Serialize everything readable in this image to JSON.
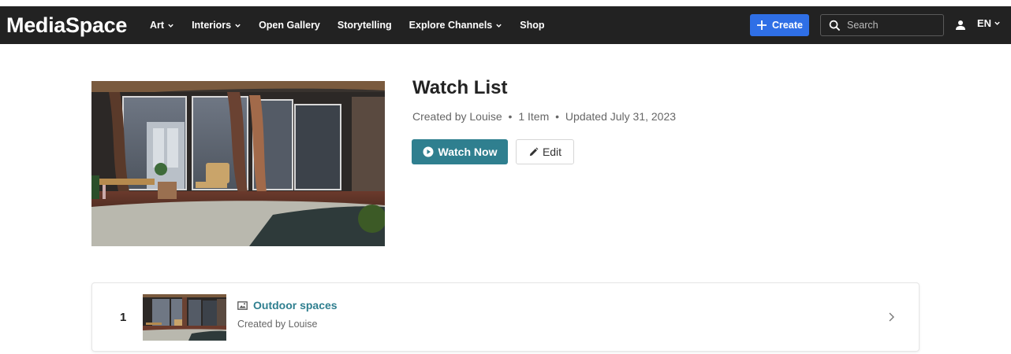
{
  "header": {
    "brand": "MediaSpace",
    "nav": [
      {
        "label": "Art",
        "has_menu": true
      },
      {
        "label": "Interiors",
        "has_menu": true
      },
      {
        "label": "Open Gallery",
        "has_menu": false
      },
      {
        "label": "Storytelling",
        "has_menu": false
      },
      {
        "label": "Explore Channels",
        "has_menu": true
      },
      {
        "label": "Shop",
        "has_menu": false
      }
    ],
    "create_label": "Create",
    "search_placeholder": "Search",
    "language": "EN"
  },
  "playlist": {
    "title": "Watch List",
    "created_by": "Created by Louise",
    "item_count": "1 Item",
    "updated": "Updated July 31, 2023",
    "watch_label": "Watch Now",
    "edit_label": "Edit"
  },
  "items": [
    {
      "index": "1",
      "title": "Outdoor spaces",
      "created_by": "Created by Louise",
      "type_icon": "image-icon"
    }
  ],
  "colors": {
    "topbar": "#222222",
    "create": "#2f6fe6",
    "accent": "#2f7f8f"
  }
}
